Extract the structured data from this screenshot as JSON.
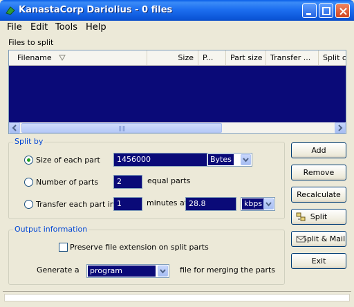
{
  "window": {
    "title": "KanastaCorp Dariolius - 0 files"
  },
  "menu": [
    {
      "label": "File"
    },
    {
      "label": "Edit"
    },
    {
      "label": "Tools"
    },
    {
      "label": "Help"
    }
  ],
  "files_label": "Files to split",
  "list": {
    "columns": [
      "Filename",
      "Size",
      "P...",
      "Part size",
      "Transfer ...",
      "Split c"
    ],
    "rows": []
  },
  "split_by": {
    "title": "Split by",
    "size_option": {
      "label": "Size of each part",
      "value": "1456000",
      "unit": "Bytes",
      "selected": true
    },
    "number_option": {
      "label": "Number of parts",
      "value": "2",
      "suffix": "equal parts",
      "selected": false
    },
    "transfer_option": {
      "label": "Transfer each part in",
      "minutes": "1",
      "minutes_at": "minutes at",
      "rate": "28.8",
      "rate_unit": "kbps",
      "selected": false
    }
  },
  "output": {
    "title": "Output information",
    "preserve_label": "Preserve file extension on split parts",
    "preserve_checked": false,
    "generate_label": "Generate a",
    "generate_value": "program",
    "generate_suffix": "file for merging the parts"
  },
  "buttons": {
    "add": "Add",
    "remove": "Remove",
    "recalculate": "Recalculate",
    "split": "Split",
    "split_mail": "Split & Mail",
    "exit": "Exit"
  },
  "colors": {
    "accent": "#0046d5",
    "selection": "#0a0a78",
    "titlebar": "#0b55d8"
  },
  "icons": [
    "app-icon",
    "minimize-icon",
    "maximize-icon",
    "close-icon",
    "sort-arrow-icon",
    "split-icon",
    "mail-icon"
  ]
}
